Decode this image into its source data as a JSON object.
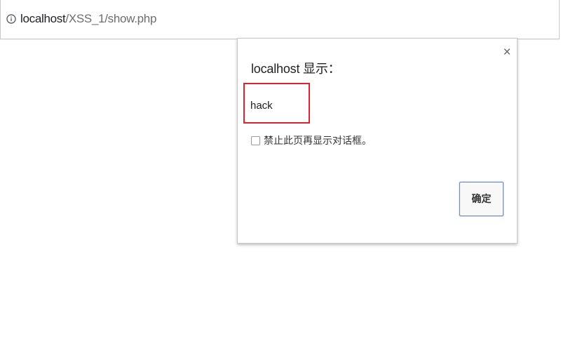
{
  "browser": {
    "url_host": "localhost",
    "url_path": "/XSS_1/show.php",
    "info_icon": "info-circle-icon"
  },
  "dialog": {
    "title": "localhost 显示：",
    "message": "hack",
    "suppress_label": "禁止此页再显示对话框。",
    "suppress_checked": false,
    "ok_label": "确定",
    "close_glyph": "×",
    "highlight_color": "#d9242e",
    "button_focus_color": "#4d90fe"
  }
}
